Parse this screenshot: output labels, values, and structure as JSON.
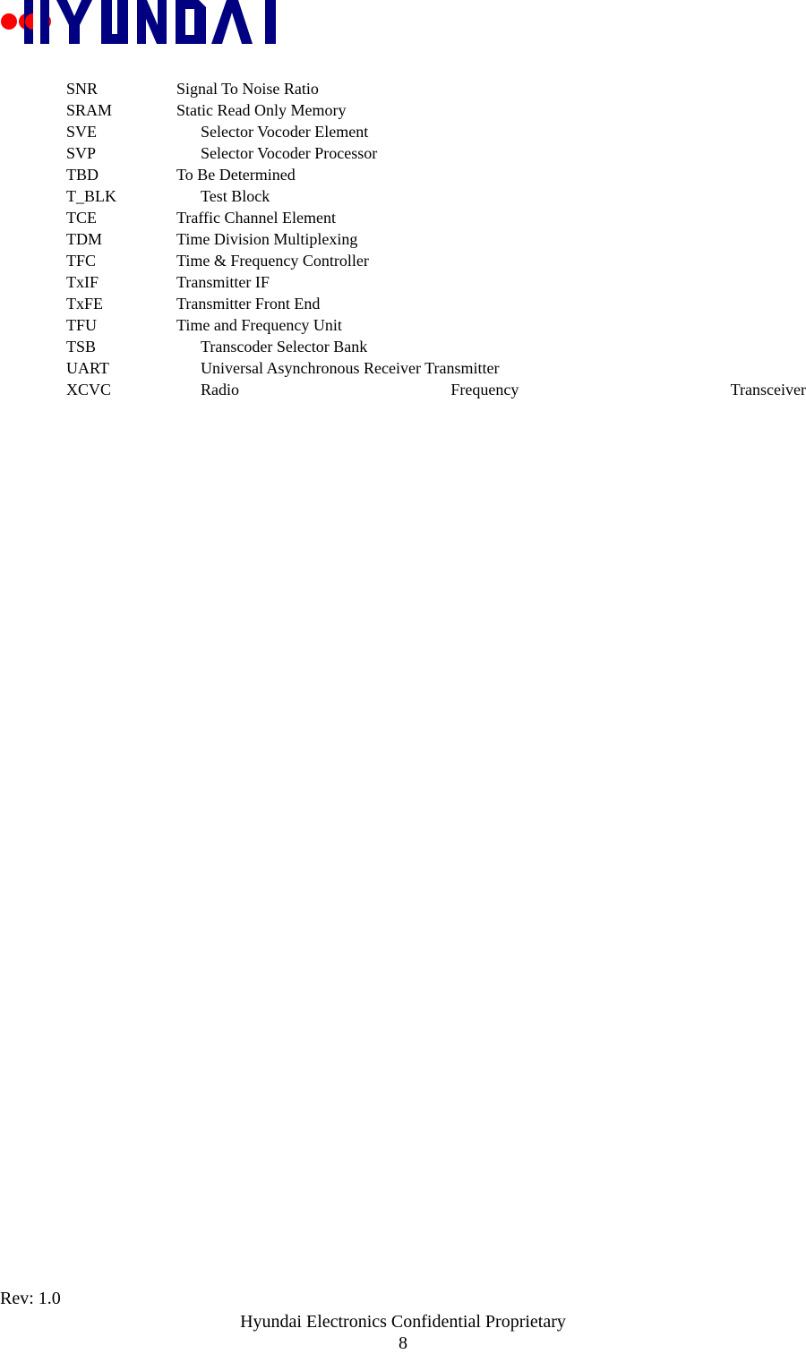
{
  "header": {
    "logo_text": "HYUNDAI",
    "logo_colors": {
      "letters": "#000080",
      "circles": "#ff0000"
    }
  },
  "glossary": [
    {
      "abbr": "SNR",
      "definition": "Signal To Noise Ratio",
      "indent": false
    },
    {
      "abbr": "SRAM",
      "definition": "Static Read Only Memory",
      "indent": false
    },
    {
      "abbr": "SVE",
      "definition": "Selector Vocoder Element",
      "indent": true
    },
    {
      "abbr": "SVP",
      "definition": "Selector Vocoder Processor",
      "indent": true
    },
    {
      "abbr": "TBD",
      "definition": "To Be Determined",
      "indent": false
    },
    {
      "abbr": "T_BLK",
      "definition": "Test Block",
      "indent": true
    },
    {
      "abbr": "TCE",
      "definition": "Traffic Channel Element",
      "indent": false
    },
    {
      "abbr": "TDM",
      "definition": "Time Division Multiplexing",
      "indent": false
    },
    {
      "abbr": "TFC",
      "definition": "Time & Frequency Controller",
      "indent": false
    },
    {
      "abbr": "TxIF",
      "definition": "Transmitter IF",
      "indent": false
    },
    {
      "abbr": "TxFE",
      "definition": "Transmitter Front End",
      "indent": false
    },
    {
      "abbr": "TFU",
      "definition": "Time and Frequency Unit",
      "indent": false
    },
    {
      "abbr": "TSB",
      "definition": "Transcoder Selector Bank",
      "indent": true
    },
    {
      "abbr": "UART",
      "definition": "Universal Asynchronous Receiver Transmitter",
      "indent": true
    },
    {
      "abbr": "XCVC",
      "definition_words": [
        "Radio",
        "Frequency",
        "Transceiver"
      ],
      "indent": true
    }
  ],
  "footer": {
    "revision": "Rev: 1.0",
    "confidential": "Hyundai Electronics Confidential Proprietary",
    "page_number": "8"
  }
}
